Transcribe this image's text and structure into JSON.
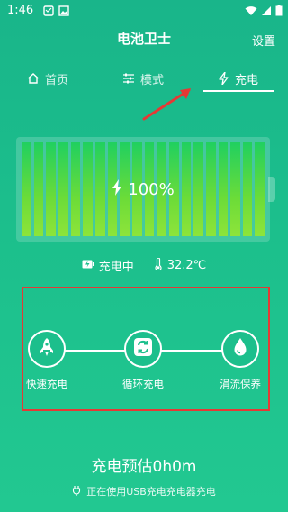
{
  "status_bar": {
    "time": "1:46",
    "icons": [
      "notification-icon",
      "image-icon",
      "wifi-icon",
      "signal-icon",
      "battery-icon"
    ]
  },
  "app": {
    "title": "电池卫士",
    "settings_label": "设置"
  },
  "tabs": [
    {
      "label": "首页",
      "icon": "home-icon",
      "selected": false
    },
    {
      "label": "模式",
      "icon": "sliders-icon",
      "selected": false
    },
    {
      "label": "充电",
      "icon": "bolt-icon",
      "selected": true
    }
  ],
  "battery": {
    "level_text": "100%",
    "level": 1.0,
    "color_fill": "#7ddc3c"
  },
  "charge_status": {
    "state": "充电中",
    "temperature": "32.2℃"
  },
  "modes": [
    {
      "label": "快速充电",
      "icon": "rocket-icon"
    },
    {
      "label": "循环充电",
      "icon": "cycle-icon"
    },
    {
      "label": "涓流保养",
      "icon": "droplet-icon"
    }
  ],
  "estimate": "充电预估0h0m",
  "usb_info": "正在使用USB充电充电器充电",
  "colors": {
    "background": "#1cbf8c",
    "highlight_border": "#e53935",
    "arrow": "#e53935"
  }
}
